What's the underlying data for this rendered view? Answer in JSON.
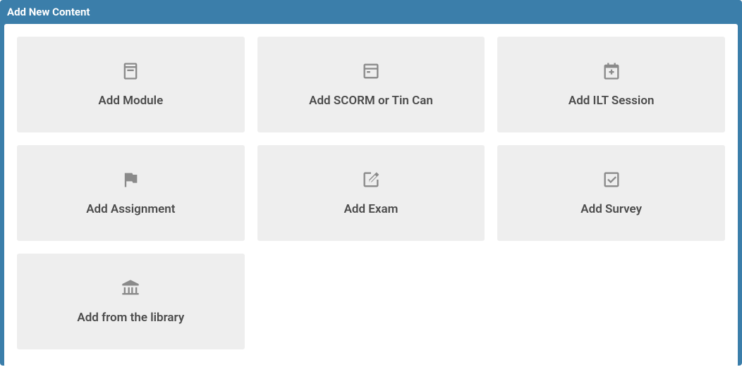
{
  "header": {
    "title": "Add New Content"
  },
  "cards": [
    {
      "label": "Add Module",
      "icon": "book-icon"
    },
    {
      "label": "Add SCORM or Tin Can",
      "icon": "window-icon"
    },
    {
      "label": "Add ILT Session",
      "icon": "calendar-plus-icon"
    },
    {
      "label": "Add Assignment",
      "icon": "flag-icon"
    },
    {
      "label": "Add Exam",
      "icon": "edit-square-icon"
    },
    {
      "label": "Add Survey",
      "icon": "check-square-icon"
    },
    {
      "label": "Add from the library",
      "icon": "library-icon"
    }
  ]
}
